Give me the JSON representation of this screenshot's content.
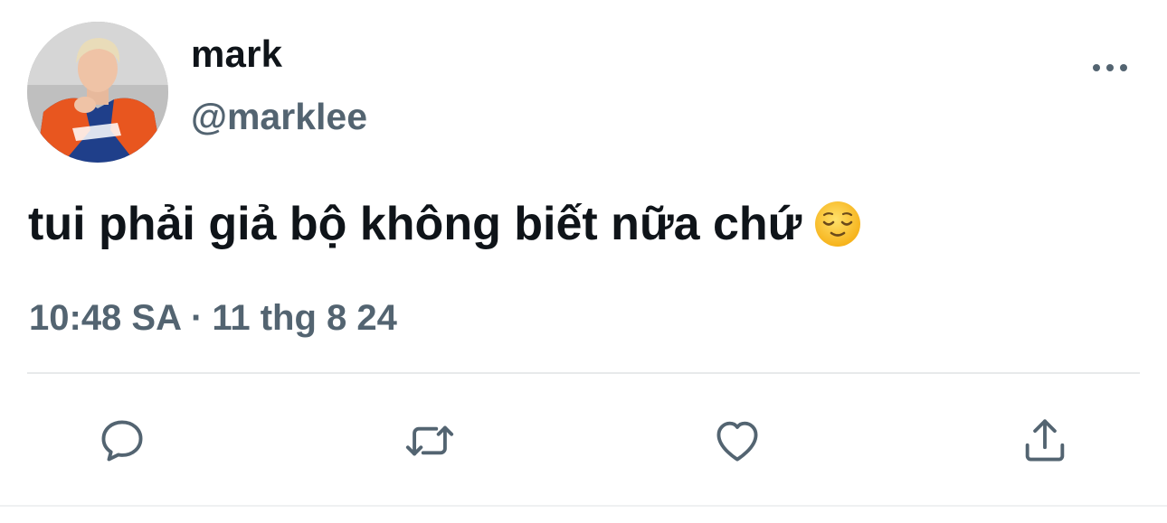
{
  "tweet": {
    "display_name": "mark",
    "handle": "@marklee",
    "text": "tui phải giả bộ không biết nữa chứ",
    "emoji": "relieved-face-emoji",
    "time": "10:48 SA",
    "separator": "·",
    "date": "11 thg 8 24"
  },
  "icons": {
    "more": "more-horizontal-icon",
    "reply": "reply-icon",
    "retweet": "retweet-icon",
    "like": "heart-icon",
    "share": "share-icon"
  },
  "colors": {
    "text_primary": "#0f1419",
    "text_secondary": "#536471",
    "divider": "#e7e9ea",
    "emoji_yellow": "#fcc21b"
  }
}
